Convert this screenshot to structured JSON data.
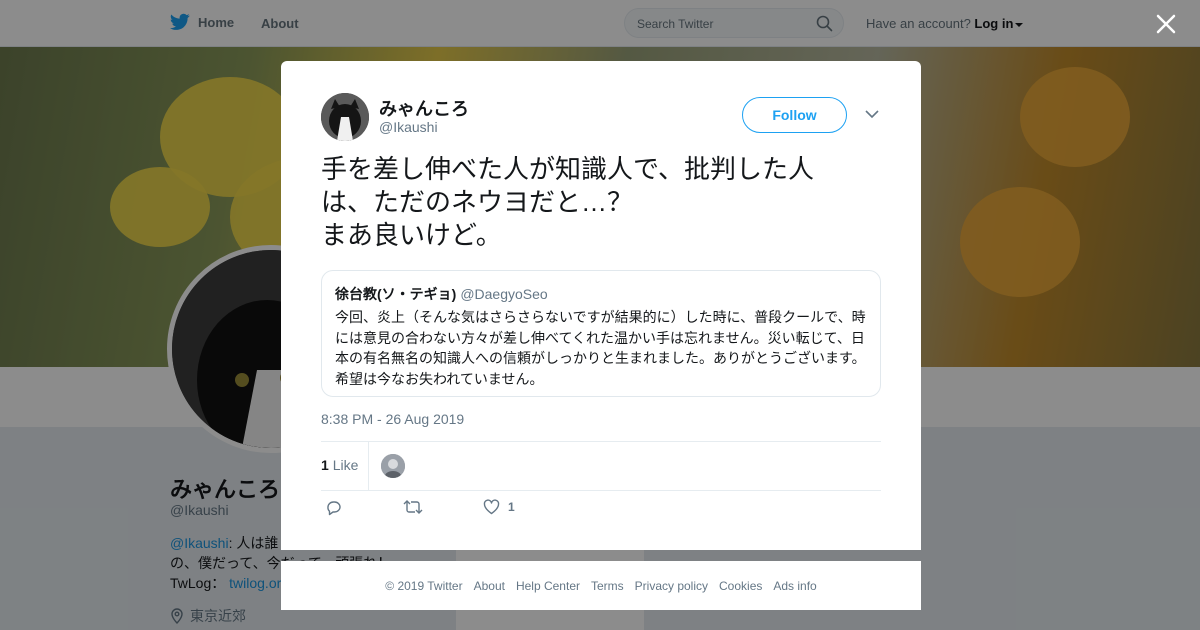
{
  "nav": {
    "home_label": "Home",
    "about_label": "About",
    "search_placeholder": "Search Twitter",
    "account_prompt": "Have an account?",
    "login_label": "Log in"
  },
  "profile": {
    "name": "みゃんころ",
    "handle": "@Ikaushi",
    "bio_mention": "@Ikaushi",
    "bio_line1": ": 人は誰",
    "bio_line2": "の、僕だって、今だ",
    "bio_line2_tail": "って、頑張れ！",
    "twlog_label": "TwLog：",
    "twlog_link": "twilog.or",
    "location": "東京近郊"
  },
  "tweet": {
    "author_name": "みゃんころ",
    "author_handle": "@Ikaushi",
    "follow_label": "Follow",
    "text": "手を差し伸べた人が知識人で、批判した人\nは、ただのネウヨだと…？\nまあ良いけど。",
    "quote": {
      "name": "徐台教(ソ・テギョ)",
      "handle": "@DaegyoSeo",
      "text": "今回、炎上（そんな気はさらさらないですが結果的に）した時に、普段クールで、時には意見の合わない方々が差し伸べてくれた温かい手は忘れません。災い転じて、日本の有名無名の知識人への信頼がしっかりと生まれました。ありがとうございます。希望は今なお失われていません。"
    },
    "timestamp": "8:38 PM - 26 Aug 2019",
    "like_count": "1",
    "like_label": "Like",
    "action_like_count": "1"
  },
  "footer": {
    "copyright": "© 2019 Twitter",
    "about": "About",
    "help": "Help Center",
    "terms": "Terms",
    "privacy": "Privacy policy",
    "cookies": "Cookies",
    "ads": "Ads info"
  },
  "colors": {
    "brand_blue": "#1da1f2",
    "link_blue": "#1b95e0",
    "text": "#14171a",
    "muted": "#657786"
  },
  "icons": [
    "twitter-bird-icon",
    "search-icon",
    "caret-down-icon",
    "close-icon",
    "chevron-down-icon",
    "reply-icon",
    "retweet-icon",
    "heart-icon",
    "location-pin-icon"
  ]
}
